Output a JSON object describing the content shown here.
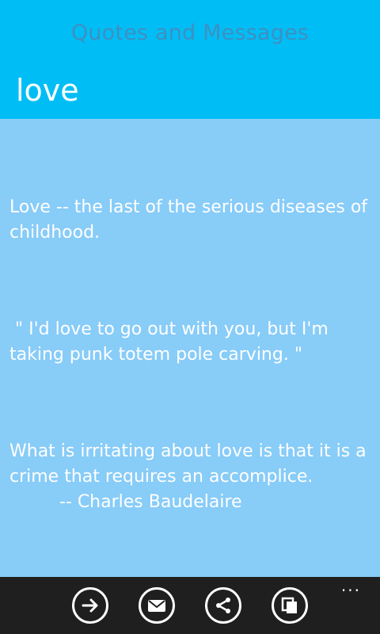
{
  "header": {
    "app_title": "Quotes and Messages",
    "page_title": "love"
  },
  "quotes": [
    {
      "text": "Love -- the last of the serious diseases of childhood."
    },
    {
      "text": " \" I'd love to go out with you, but I'm taking punk totem pole carving. \""
    },
    {
      "text": "What is irritating about love is that it is a crime that requires an accomplice.\n         -- Charles Baudelaire"
    }
  ],
  "appbar": {
    "buttons": [
      {
        "icon": "arrow-right-icon"
      },
      {
        "icon": "mail-icon"
      },
      {
        "icon": "share-icon"
      },
      {
        "icon": "copy-icon"
      }
    ],
    "more_label": "..."
  },
  "colors": {
    "header_bg": "#00bef5",
    "content_bg": "#88ccf8",
    "appbar_bg": "#1f1f1f",
    "app_title": "#3f8fc2"
  }
}
